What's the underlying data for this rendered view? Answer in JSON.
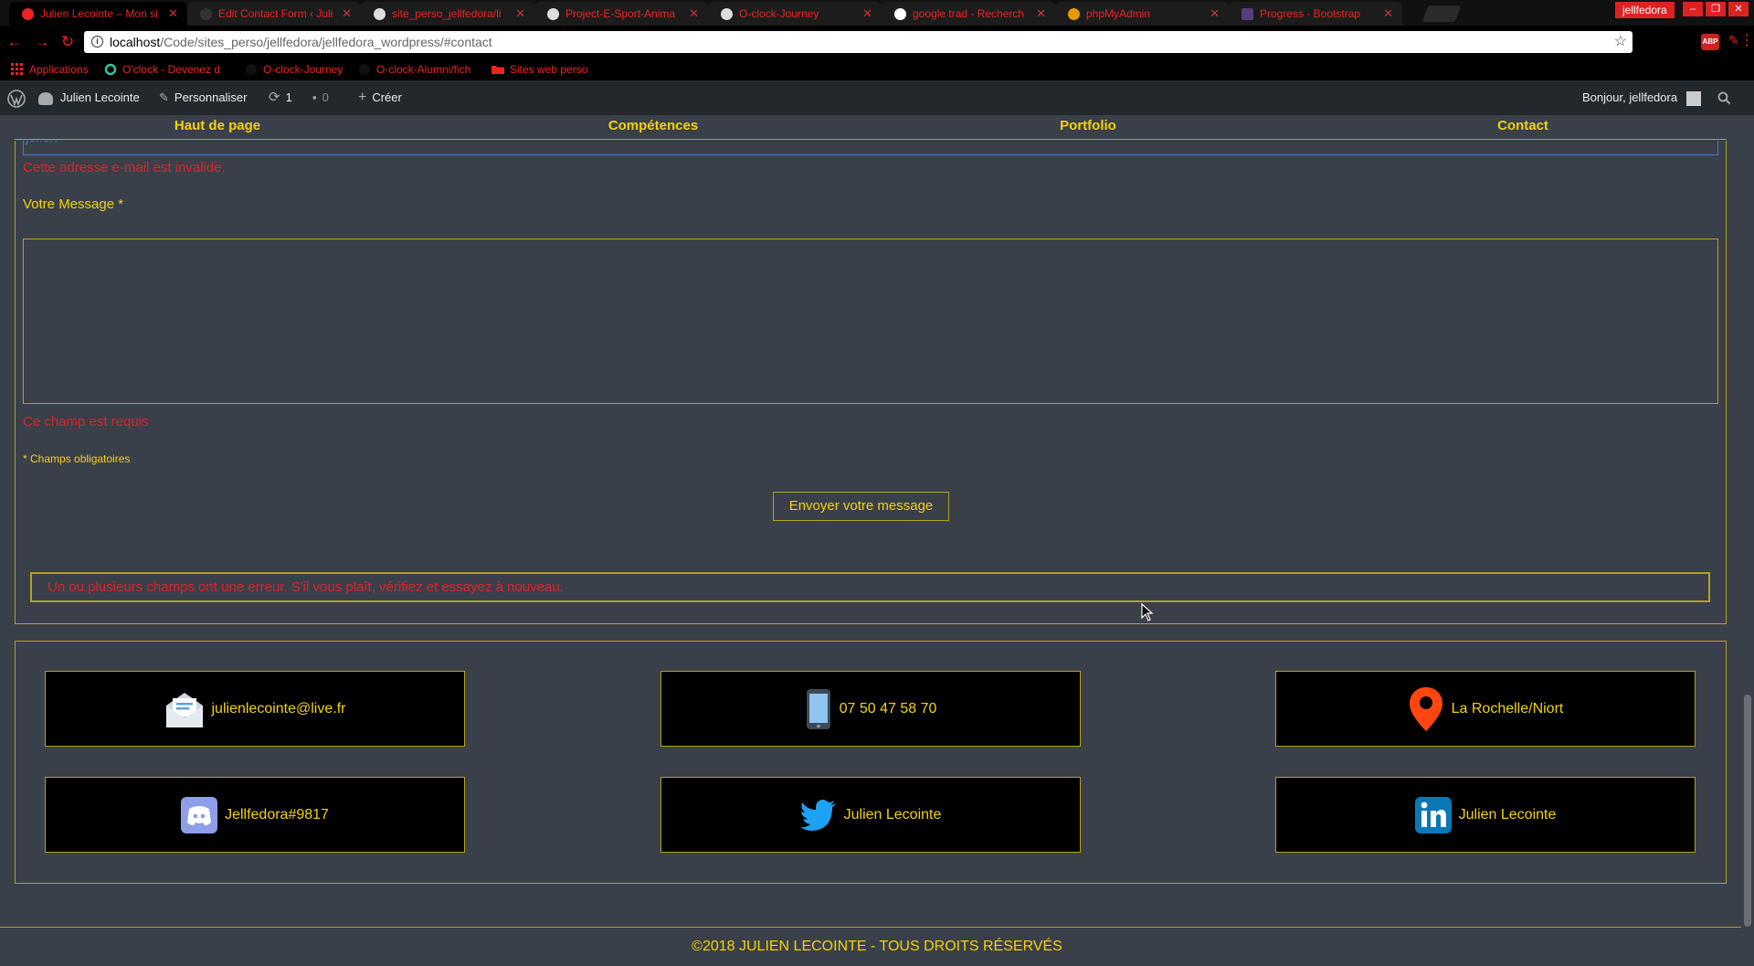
{
  "browser": {
    "tabs": [
      {
        "title": "Julien Lecointe – Mon si",
        "active": true
      },
      {
        "title": "Edit Contact Form ‹ Juli",
        "active": false
      },
      {
        "title": "site_perso_jellfedora/li",
        "active": false
      },
      {
        "title": "Project-E-Sport-Anima",
        "active": false
      },
      {
        "title": "O-clock-Journey",
        "active": false
      },
      {
        "title": "google trad - Recherch",
        "active": false
      },
      {
        "title": "phpMyAdmin",
        "active": false
      },
      {
        "title": "Progress · Bootstrap",
        "active": false
      }
    ],
    "profile_name": "jellfedora",
    "url_host": "localhost",
    "url_path": "/Code/sites_perso/jellfedora/jellfedora_wordpress/#contact",
    "bookmarks": [
      {
        "label": "Applications",
        "icon": "apps-grid-icon"
      },
      {
        "label": "O'clock - Devenez d",
        "icon": "oclock-icon"
      },
      {
        "label": "O-clock-Journey",
        "icon": "github-icon"
      },
      {
        "label": "O-clock-Alumni/fich",
        "icon": "github-icon"
      },
      {
        "label": "Sites web perso",
        "icon": "folder-icon"
      }
    ]
  },
  "admin_bar": {
    "site_name": "Julien Lecointe",
    "customize": "Personnaliser",
    "updates_count": "1",
    "comments_count": "0",
    "new": "Créer",
    "greeting": "Bonjour, jellfedora"
  },
  "site_nav": [
    "Haut de page",
    "Compétences",
    "Portfolio",
    "Contact"
  ],
  "form": {
    "email_value": "julien",
    "email_error": "Cette adresse e-mail est invalide.",
    "message_label": "Votre Message *",
    "message_value": "",
    "message_error": "Ce champ est requis",
    "required_note": "* Champs obligatoires",
    "submit_label": "Envoyer votre message",
    "form_error": "Un ou plusieurs champs ont une erreur. S'il vous plaît, vérifiez et essayez à nouveau."
  },
  "contacts": [
    {
      "label": "julienlecointe@live.fr",
      "icon": "mail-icon"
    },
    {
      "label": "07 50 47 58 70",
      "icon": "phone-icon"
    },
    {
      "label": "La Rochelle/Niort",
      "icon": "map-pin-icon"
    },
    {
      "label": "Jellfedora#9817",
      "icon": "discord-icon"
    },
    {
      "label": "Julien Lecointe",
      "icon": "twitter-icon"
    },
    {
      "label": "Julien Lecointe",
      "icon": "linkedin-icon"
    }
  ],
  "footer": {
    "copyright": "©2018 JULIEN LECOINTE - TOUS DROITS RÉSERVÉS"
  },
  "colors": {
    "accent": "#f4d20f",
    "error": "#e0202c",
    "background": "#394049",
    "border": "#b7a21d"
  }
}
